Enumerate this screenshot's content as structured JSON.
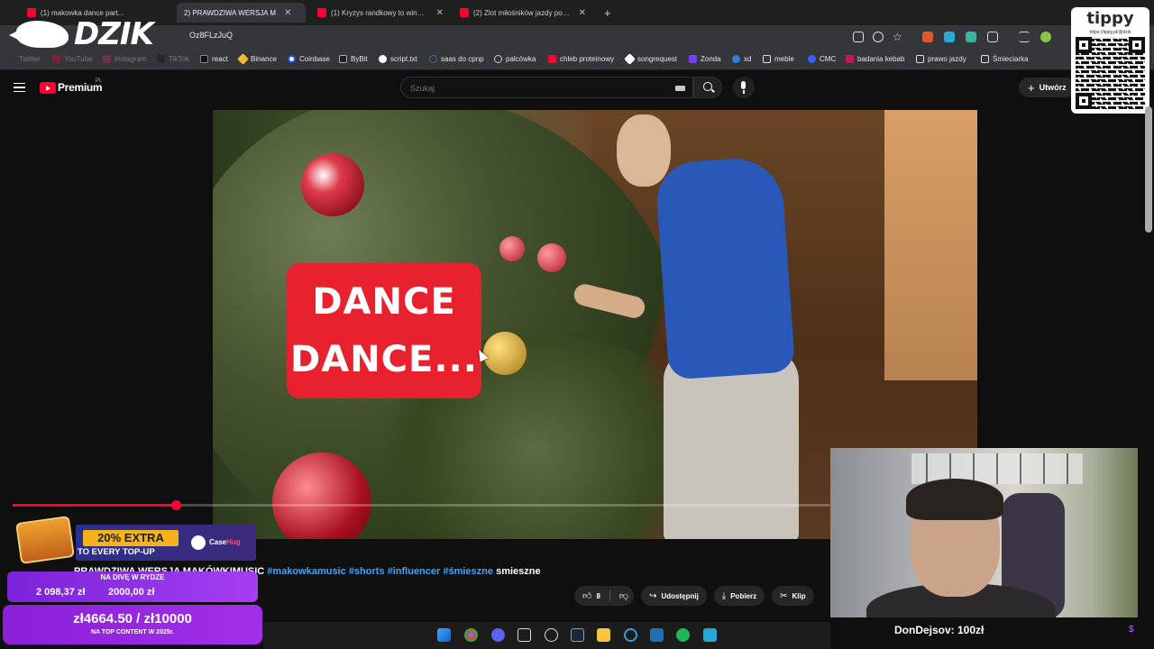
{
  "browser": {
    "tabs": [
      {
        "title": "(1) makowka dance part..."
      },
      {
        "title": "2) PRAWDZIWA WERSJA M"
      },
      {
        "title": "(1) Kryzys randkowy to wina ew"
      },
      {
        "title": "(2) Zlot miłośników jazdy po ch"
      }
    ],
    "url": "Oz8FLzJuQ",
    "bookmarks": [
      "Twitter",
      "YouTube",
      "Instagram",
      "TikTok",
      "react",
      "Binance",
      "Coinbase",
      "ByBit",
      "script.txt",
      "saas do cpnp",
      "palcówka",
      "chleb proteinowy",
      "songrequest",
      "Zonda",
      "xd",
      "meble",
      "CMC",
      "badania kebab",
      "prawo jazdy",
      "Śmieciarka"
    ]
  },
  "header": {
    "brand": "Premium",
    "brand_region": "PL",
    "search_placeholder": "Szukaj",
    "create_label": "Utwórz"
  },
  "video": {
    "caption": "DANCE\nDANCE...",
    "progress": 0.2,
    "title_prefix": "PRAWDZIWA WERSJA MAKÓWKIMUSIC",
    "hashtags": [
      "#makowkamusic",
      "#shorts",
      "#influencer",
      "#śmieszne"
    ],
    "title_suffix": "smieszne"
  },
  "actions": {
    "like_count": "8",
    "share_label": "Udostępnij",
    "download_label": "Pobierz",
    "clip_label": "Klip"
  },
  "overlays": {
    "logo_text": "DZIK",
    "tippy_name": "tippy",
    "tippy_url": "https://tippy.pl/@dzik",
    "promo_badge": "20% EXTRA",
    "promo_line": "TO EVERY TOP-UP",
    "promo_brand_a": "Case",
    "promo_brand_b": "Hug",
    "goal1_title": "NA DIVĘ W RYDZE",
    "goal1_amount": "2 098,37 zł",
    "goal1_target": "2000,00 zł",
    "goal2_amount": "zł4664.50 / zł10000",
    "goal2_sub": "NA TOP CONTENT W 2025r.",
    "donation": "DonDejsov:  100zł"
  },
  "colors": {
    "accent": "#ff0033",
    "link": "#3ea6ff",
    "goal": "#a63ef3",
    "caption_bg": "#e8212f"
  }
}
